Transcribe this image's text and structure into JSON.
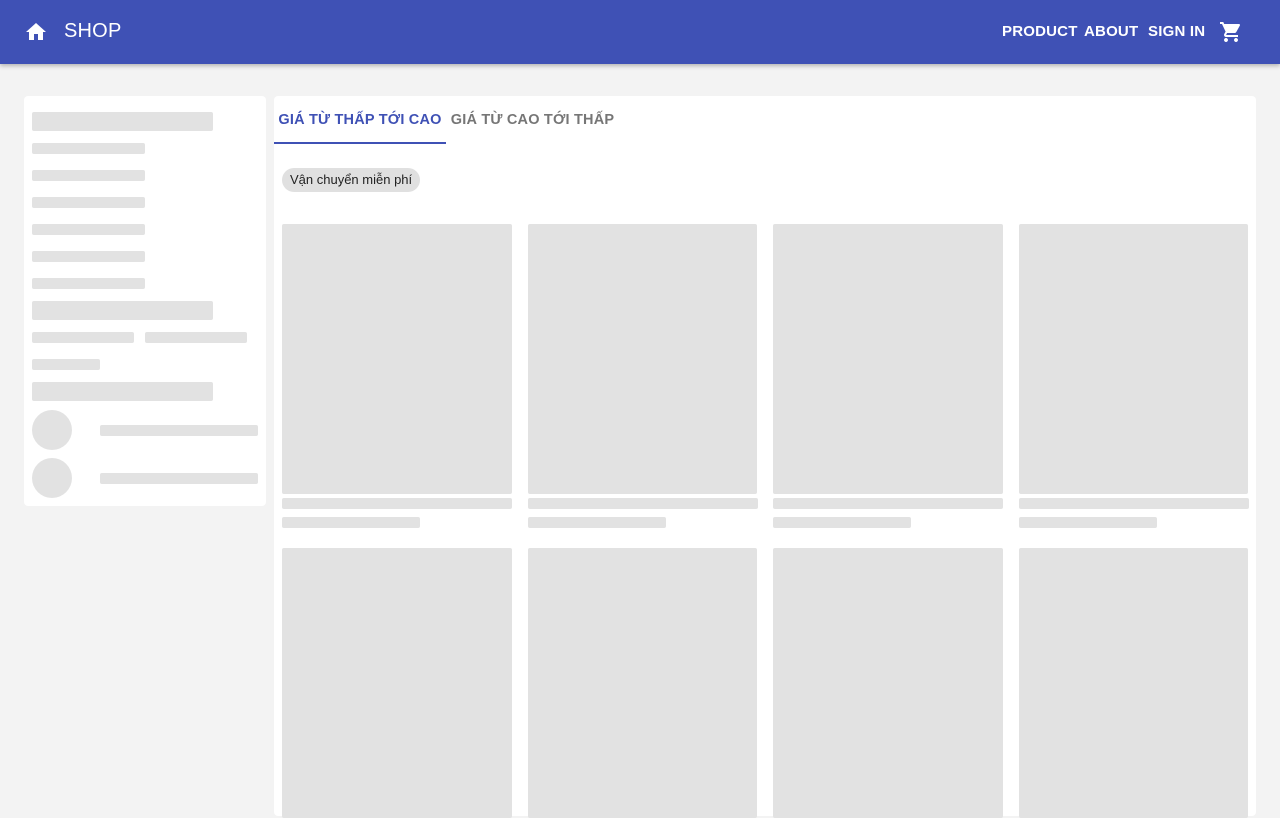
{
  "header": {
    "brand": "SHOP",
    "nav": {
      "product": "PRODUCT",
      "about": "ABOUT",
      "sign_in": "SIGN IN"
    },
    "icons": {
      "home": "home-icon",
      "cart": "shopping-cart-icon"
    },
    "colors": {
      "app_bar": "#3f51b5",
      "text": "#ffffff"
    }
  },
  "sort_tabs": [
    {
      "label": "GIÁ TỪ THẤP TỚI CAO",
      "selected": true
    },
    {
      "label": "GIÁ TỪ CAO TỚI THẤP",
      "selected": false
    }
  ],
  "filters": {
    "chips": [
      {
        "label": "Vận chuyển miễn phí"
      }
    ]
  },
  "colors": {
    "page_background": "#f3f3f3",
    "panel_background": "#ffffff",
    "skeleton": "#e2e2e2",
    "accent": "#3f51b5",
    "inactive_tab": "#767676"
  }
}
